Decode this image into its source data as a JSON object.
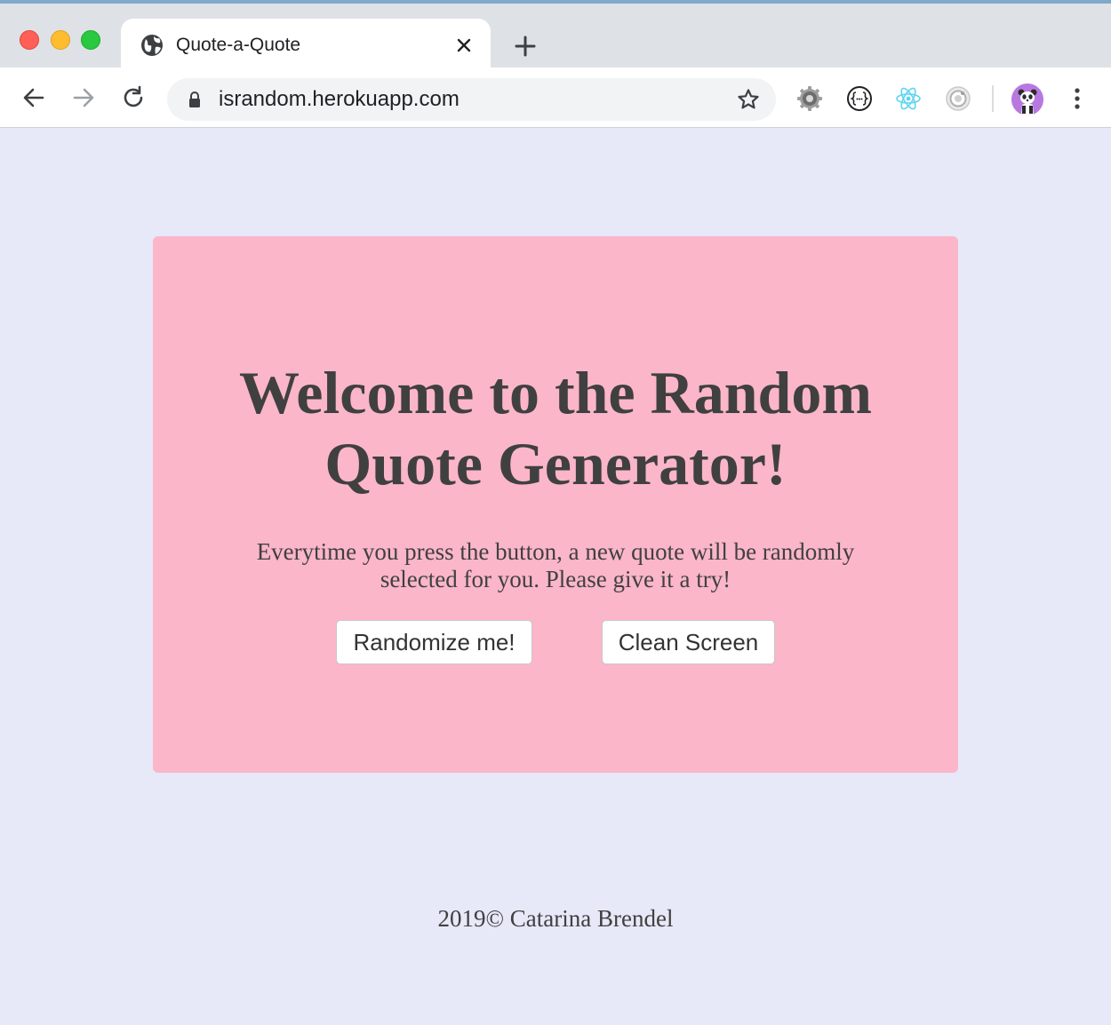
{
  "browser": {
    "tab": {
      "title": "Quote-a-Quote",
      "favicon": "globe-icon"
    },
    "address_bar": {
      "url": "israndom.herokuapp.com"
    },
    "extensions": [
      "gear-icon",
      "json-formatter-icon",
      "react-devtools-icon",
      "target-icon"
    ],
    "profile_avatar": "panda-avatar"
  },
  "page": {
    "background_color": "#e7e8f8",
    "card_color": "#fbb6c9",
    "heading": "Welcome to the Random Quote Generator!",
    "intro": "Everytime you press the button, a new quote will be randomly selected for you. Please give it a try!",
    "buttons": {
      "randomize": "Randomize me!",
      "clean": "Clean Screen"
    },
    "footer": "2019© Catarina Brendel"
  }
}
